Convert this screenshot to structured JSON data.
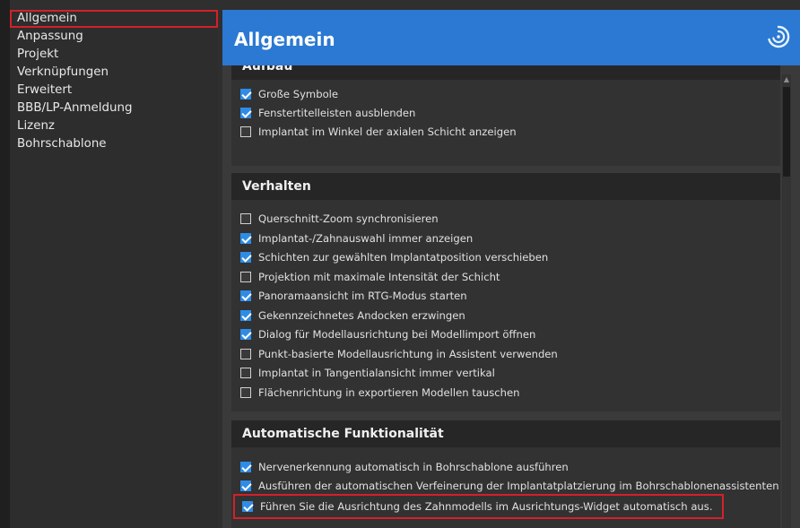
{
  "sidebar": {
    "items": [
      {
        "label": "Allgemein",
        "selected": true
      },
      {
        "label": "Anpassung"
      },
      {
        "label": "Projekt"
      },
      {
        "label": "Verknüpfungen"
      },
      {
        "label": "Erweitert"
      },
      {
        "label": "BBB/LP-Anmeldung"
      },
      {
        "label": "Lizenz"
      },
      {
        "label": "Bohrschablone"
      }
    ]
  },
  "header": {
    "title": "Allgemein",
    "logo_icon": "spiral-logo-icon"
  },
  "colors": {
    "accent": "#2b79d2",
    "checkbox": "#2f8ce6",
    "highlight": "#d3202a"
  },
  "sections": [
    {
      "title": "Aufbau",
      "options": [
        {
          "label": "Große Symbole",
          "checked": true
        },
        {
          "label": "Fenstertitelleisten ausblenden",
          "checked": true
        },
        {
          "label": "Implantat im Winkel der axialen Schicht anzeigen",
          "checked": false
        }
      ]
    },
    {
      "title": "Verhalten",
      "options": [
        {
          "label": "Querschnitt-Zoom synchronisieren",
          "checked": false
        },
        {
          "label": "Implantat-/Zahnauswahl immer anzeigen",
          "checked": true
        },
        {
          "label": "Schichten zur gewählten Implantatposition verschieben",
          "checked": true
        },
        {
          "label": "Projektion mit maximale Intensität der Schicht",
          "checked": false
        },
        {
          "label": "Panoramaansicht im RTG-Modus starten",
          "checked": true
        },
        {
          "label": "Gekennzeichnetes Andocken erzwingen",
          "checked": true
        },
        {
          "label": "Dialog für Modellausrichtung bei Modellimport öffnen",
          "checked": true
        },
        {
          "label": "Punkt-basierte Modellausrichtung in Assistent verwenden",
          "checked": false
        },
        {
          "label": "Implantat in Tangentialansicht immer vertikal",
          "checked": false
        },
        {
          "label": "Flächenrichtung in exportieren Modellen tauschen",
          "checked": false
        }
      ]
    },
    {
      "title": "Automatische Funktionalität",
      "options": [
        {
          "label": "Nervenerkennung automatisch in Bohrschablone ausführen",
          "checked": true
        },
        {
          "label": "Ausführen der automatischen Verfeinerung der Implantatplatzierung im Bohrschablonenassistenten",
          "checked": true
        },
        {
          "label": "Führen Sie die Ausrichtung des Zahnmodells im Ausrichtungs-Widget automatisch aus.",
          "checked": true,
          "highlighted": true
        }
      ]
    }
  ]
}
